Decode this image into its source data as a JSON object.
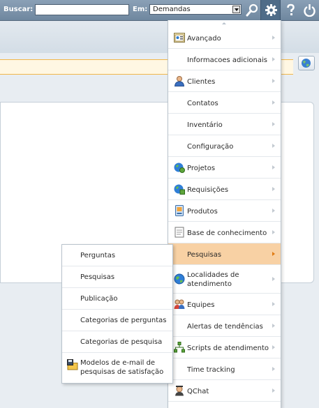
{
  "topbar": {
    "search_label": "Buscar:",
    "search_value": "",
    "in_label": "Em:",
    "in_selected": "Demandas"
  },
  "menu": {
    "items": [
      {
        "label": "Avançado",
        "icon": "advanced-icon"
      },
      {
        "label": "Informacoes adicionais",
        "icon": ""
      },
      {
        "label": "Clientes",
        "icon": "person-icon"
      },
      {
        "label": "Contatos",
        "icon": ""
      },
      {
        "label": "Inventário",
        "icon": ""
      },
      {
        "label": "Configuração",
        "icon": ""
      },
      {
        "label": "Projetos",
        "icon": "projects-icon"
      },
      {
        "label": "Requisições",
        "icon": "requests-icon"
      },
      {
        "label": "Produtos",
        "icon": "products-icon"
      },
      {
        "label": "Base de conhecimento",
        "icon": "knowledge-icon"
      },
      {
        "label": "Pesquisas",
        "icon": "",
        "active": true
      },
      {
        "label": "Localidades de atendimento",
        "icon": "globe-icon"
      },
      {
        "label": "Equipes",
        "icon": "team-icon"
      },
      {
        "label": "Alertas de tendências",
        "icon": ""
      },
      {
        "label": "Scripts de atendimento",
        "icon": "scripts-icon"
      },
      {
        "label": "Time tracking",
        "icon": ""
      },
      {
        "label": "QChat",
        "icon": "chat-icon"
      }
    ]
  },
  "submenu": {
    "items": [
      {
        "label": "Perguntas"
      },
      {
        "label": "Pesquisas"
      },
      {
        "label": "Publicação"
      },
      {
        "label": "Categorias de perguntas"
      },
      {
        "label": "Categorias de pesquisa"
      },
      {
        "label": "Modelos de e-mail de pesquisas de satisfação",
        "icon": "save-folder-icon"
      }
    ]
  },
  "colors": {
    "topbar": "#7891a9",
    "active_item": "#f8d1a4",
    "active_arrow": "#e07b12",
    "notice_border": "#f1b74a"
  }
}
